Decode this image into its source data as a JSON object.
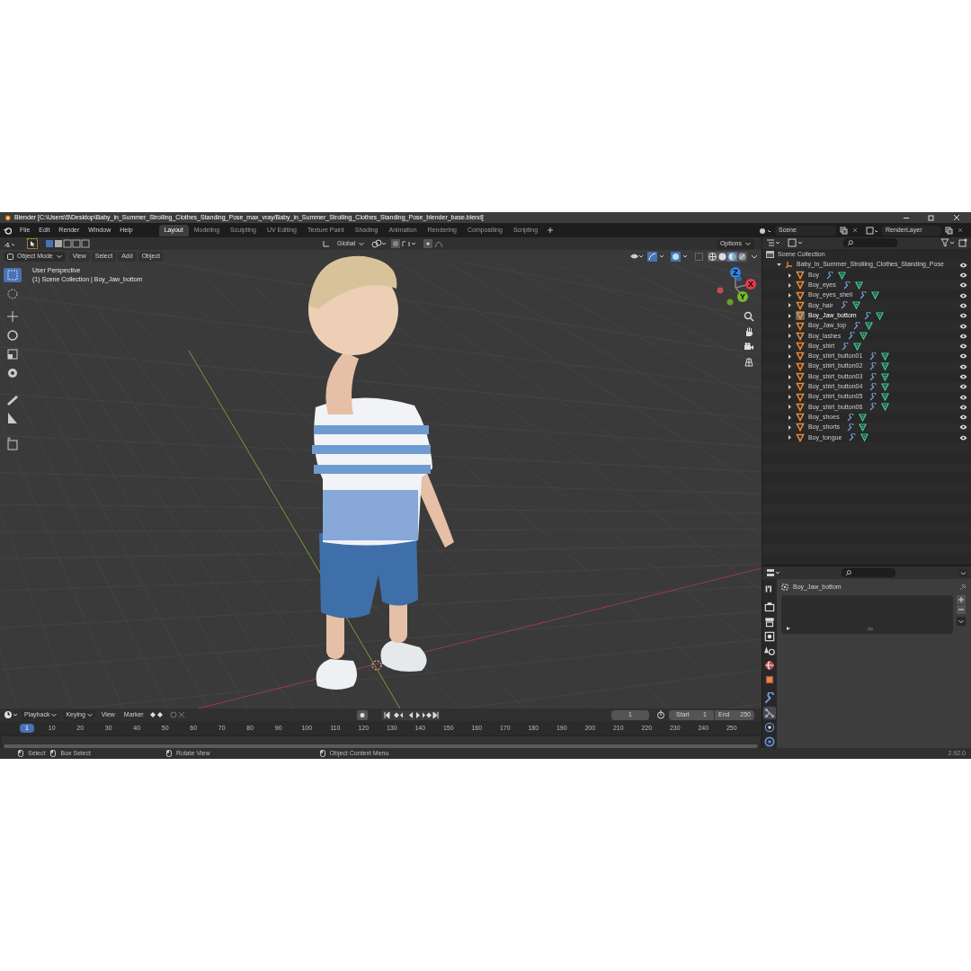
{
  "window": {
    "title": "Blender [C:\\Users\\5\\Desktop\\Baby_in_Summer_Strolling_Clothes_Standing_Pose_max_vray/Baby_in_Summer_Strolling_Clothes_Standing_Pose_blender_base.blend]"
  },
  "menu": [
    "File",
    "Edit",
    "Render",
    "Window",
    "Help"
  ],
  "workspaces": [
    {
      "label": "Layout",
      "selected": true
    },
    {
      "label": "Modeling",
      "selected": false
    },
    {
      "label": "Sculpting",
      "selected": false
    },
    {
      "label": "UV Editing",
      "selected": false
    },
    {
      "label": "Texture Paint",
      "selected": false
    },
    {
      "label": "Shading",
      "selected": false
    },
    {
      "label": "Animation",
      "selected": false
    },
    {
      "label": "Rendering",
      "selected": false
    },
    {
      "label": "Compositing",
      "selected": false
    },
    {
      "label": "Scripting",
      "selected": false
    }
  ],
  "scene": "Scene",
  "view_layer": "RenderLayer",
  "viewport": {
    "orientation": "Global",
    "options": "Options",
    "mode": "Object Mode",
    "menus": [
      "View",
      "Select",
      "Add",
      "Object"
    ],
    "overlay_text": [
      "User Perspective",
      "(1) Scene Collection | Boy_Jaw_bottom"
    ],
    "shading": [
      {
        "kind": "wireframe",
        "selected": false
      },
      {
        "kind": "solid",
        "selected": false
      },
      {
        "kind": "material",
        "selected": true
      },
      {
        "kind": "rendered",
        "selected": false
      }
    ],
    "gizmo_axes": [
      "Z",
      "X",
      "Y"
    ]
  },
  "outliner": {
    "title": "Scene Collection",
    "root": {
      "name": "Baby_in_Summer_Strolling_Clothes_Standing_Pose",
      "expanded": true,
      "children": [
        {
          "name": "Boy",
          "expanded": false,
          "selected": false
        },
        {
          "name": "Boy_eyes",
          "expanded": false,
          "selected": false
        },
        {
          "name": "Boy_eyes_shell",
          "expanded": false,
          "selected": false
        },
        {
          "name": "Boy_hair",
          "expanded": false,
          "selected": false
        },
        {
          "name": "Boy_Jaw_bottom",
          "expanded": false,
          "selected": true
        },
        {
          "name": "Boy_Jaw_top",
          "expanded": false,
          "selected": false
        },
        {
          "name": "Boy_lashes",
          "expanded": false,
          "selected": false
        },
        {
          "name": "Boy_shirt",
          "expanded": false,
          "selected": false
        },
        {
          "name": "Boy_shirt_button01",
          "expanded": false,
          "selected": false
        },
        {
          "name": "Boy_shirt_button02",
          "expanded": false,
          "selected": false
        },
        {
          "name": "Boy_shirt_button03",
          "expanded": false,
          "selected": false
        },
        {
          "name": "Boy_shirt_button04",
          "expanded": false,
          "selected": false
        },
        {
          "name": "Boy_shirt_button05",
          "expanded": false,
          "selected": false
        },
        {
          "name": "Boy_shirt_button06",
          "expanded": false,
          "selected": false
        },
        {
          "name": "Boy_shoes",
          "expanded": false,
          "selected": false
        },
        {
          "name": "Boy_shorts",
          "expanded": false,
          "selected": false
        },
        {
          "name": "Boy_tongue",
          "expanded": false,
          "selected": false
        }
      ]
    }
  },
  "properties": {
    "object_name": "Boy_Jaw_bottom",
    "tabs": [
      {
        "kind": "tool",
        "selected": false
      },
      {
        "kind": "render",
        "selected": false
      },
      {
        "kind": "output",
        "selected": false
      },
      {
        "kind": "view_layer",
        "selected": false
      },
      {
        "kind": "scene",
        "selected": false
      },
      {
        "kind": "world",
        "selected": false
      },
      {
        "kind": "object",
        "selected": false
      },
      {
        "kind": "modifiers",
        "selected": false
      },
      {
        "kind": "particles",
        "selected": true
      },
      {
        "kind": "physics",
        "selected": false
      },
      {
        "kind": "constraints",
        "selected": false
      }
    ]
  },
  "timeline": {
    "menus": [
      "Playback",
      "Keying",
      "View",
      "Marker"
    ],
    "current_frame": "1",
    "start_label": "Start",
    "start": "1",
    "end_label": "End",
    "end": "250",
    "playhead": "1",
    "ticks": [
      "10",
      "20",
      "30",
      "40",
      "50",
      "60",
      "70",
      "80",
      "90",
      "100",
      "110",
      "120",
      "130",
      "140",
      "150",
      "160",
      "170",
      "180",
      "190",
      "200",
      "210",
      "220",
      "230",
      "240",
      "250"
    ]
  },
  "status_bar": {
    "hints": [
      "Select",
      "Box Select",
      "Rotate View",
      "Object Context Menu"
    ],
    "version": "2.92.0"
  }
}
